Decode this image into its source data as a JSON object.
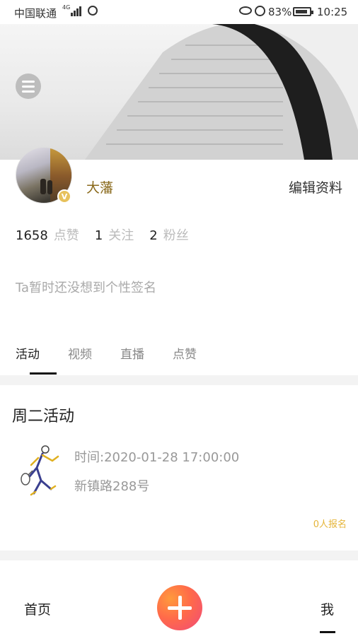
{
  "status_bar": {
    "carrier": "中国联通",
    "network": "4G",
    "battery_percent": "83%",
    "time": "10:25"
  },
  "profile": {
    "username": "大藩",
    "verified_badge": "V",
    "edit_label": "编辑资料",
    "stats": [
      {
        "value": "1658",
        "label": "点赞"
      },
      {
        "value": "1",
        "label": "关注"
      },
      {
        "value": "2",
        "label": "粉丝"
      }
    ],
    "signature": "Ta暂时还没想到个性签名"
  },
  "tabs": [
    {
      "label": "活动",
      "active": true
    },
    {
      "label": "视频",
      "active": false
    },
    {
      "label": "直播",
      "active": false
    },
    {
      "label": "点赞",
      "active": false
    }
  ],
  "activity": {
    "title": "周二活动",
    "time": "时间:2020-01-28 17:00:00",
    "address": "新镇路288号",
    "signup": "0人报名"
  },
  "bottom_nav": {
    "home": "首页",
    "me": "我"
  },
  "colors": {
    "username": "#8a6a1c",
    "signup_accent": "#e5b53a",
    "add_button_gradient": [
      "#ff9a3c",
      "#f04a7a"
    ]
  }
}
